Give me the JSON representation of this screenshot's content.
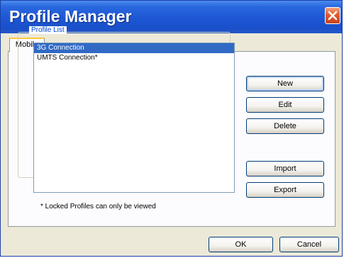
{
  "window": {
    "title": "Profile Manager"
  },
  "tabs": [
    {
      "label": "Mobile"
    }
  ],
  "profile_list": {
    "group_label": "Profile List",
    "items": [
      {
        "label": "3G Connection",
        "selected": true
      },
      {
        "label": "UMTS Connection*",
        "selected": false
      }
    ]
  },
  "buttons": {
    "new": "New",
    "edit": "Edit",
    "delete": "Delete",
    "import": "Import",
    "export": "Export",
    "ok": "OK",
    "cancel": "Cancel"
  },
  "note": "* Locked Profiles can only be viewed",
  "colors": {
    "titlebar": "#1d56d4",
    "selection": "#316ac5",
    "group_label": "#0046d5",
    "tab_accent": "#ffc83c",
    "close": "#e05a2c"
  }
}
